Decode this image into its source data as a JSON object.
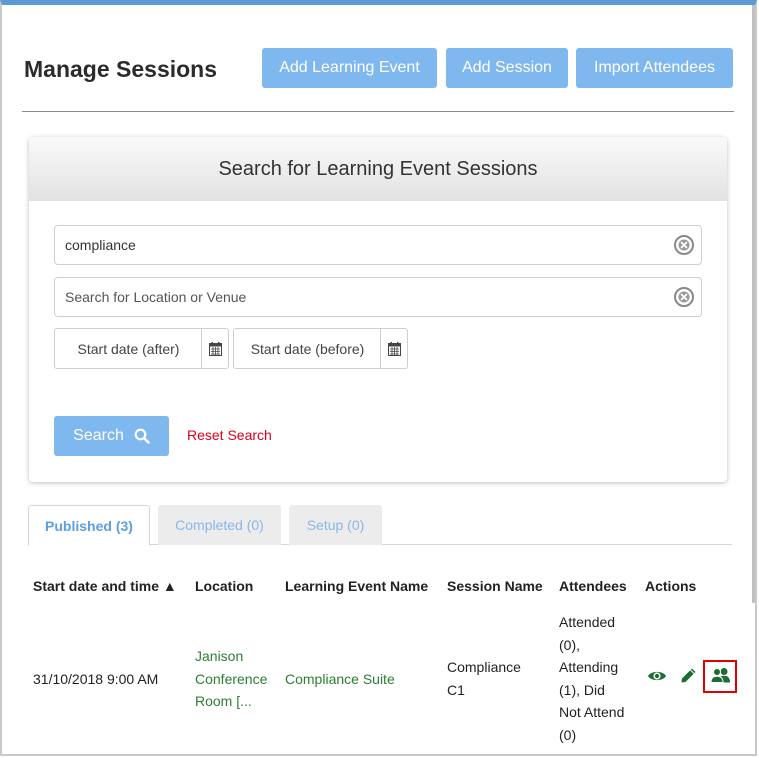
{
  "header": {
    "title": "Manage Sessions",
    "buttons": {
      "add_learning_event": "Add Learning Event",
      "add_session": "Add Session",
      "import_attendees": "Import Attendees"
    }
  },
  "search": {
    "title": "Search for Learning Event Sessions",
    "keyword_value": "compliance",
    "location_placeholder": "Search for Location or Venue",
    "start_after_placeholder": "Start date (after)",
    "start_before_placeholder": "Start date (before)",
    "search_label": "Search",
    "reset_label": "Reset Search"
  },
  "tabs": [
    {
      "label": "Published (3)",
      "active": true
    },
    {
      "label": "Completed (0)",
      "active": false
    },
    {
      "label": "Setup (0)",
      "active": false
    }
  ],
  "table": {
    "headers": [
      "Start date and time ▲",
      "Location",
      "Learning Event Name",
      "Session Name",
      "Attendees",
      "Actions"
    ],
    "rows": [
      {
        "start": "31/10/2018 9:00 AM",
        "location": [
          "Janison",
          "Conference",
          "Room [..."
        ],
        "event_name": "Compliance Suite",
        "session_name": [
          "Compliance",
          "C1"
        ],
        "attendees": [
          "Attended",
          "(0),",
          "Attending",
          "(1), Did",
          "Not Attend",
          "(0)"
        ]
      }
    ]
  },
  "colors": {
    "accent_blue": "#7fb7ef",
    "link_green": "#2e7d32",
    "reset_red": "#e0001a",
    "highlight_red": "#e00000"
  },
  "icons": [
    "clear-icon",
    "calendar-icon",
    "magnifier-icon",
    "eye-icon",
    "pencil-icon",
    "attendees-icon"
  ]
}
